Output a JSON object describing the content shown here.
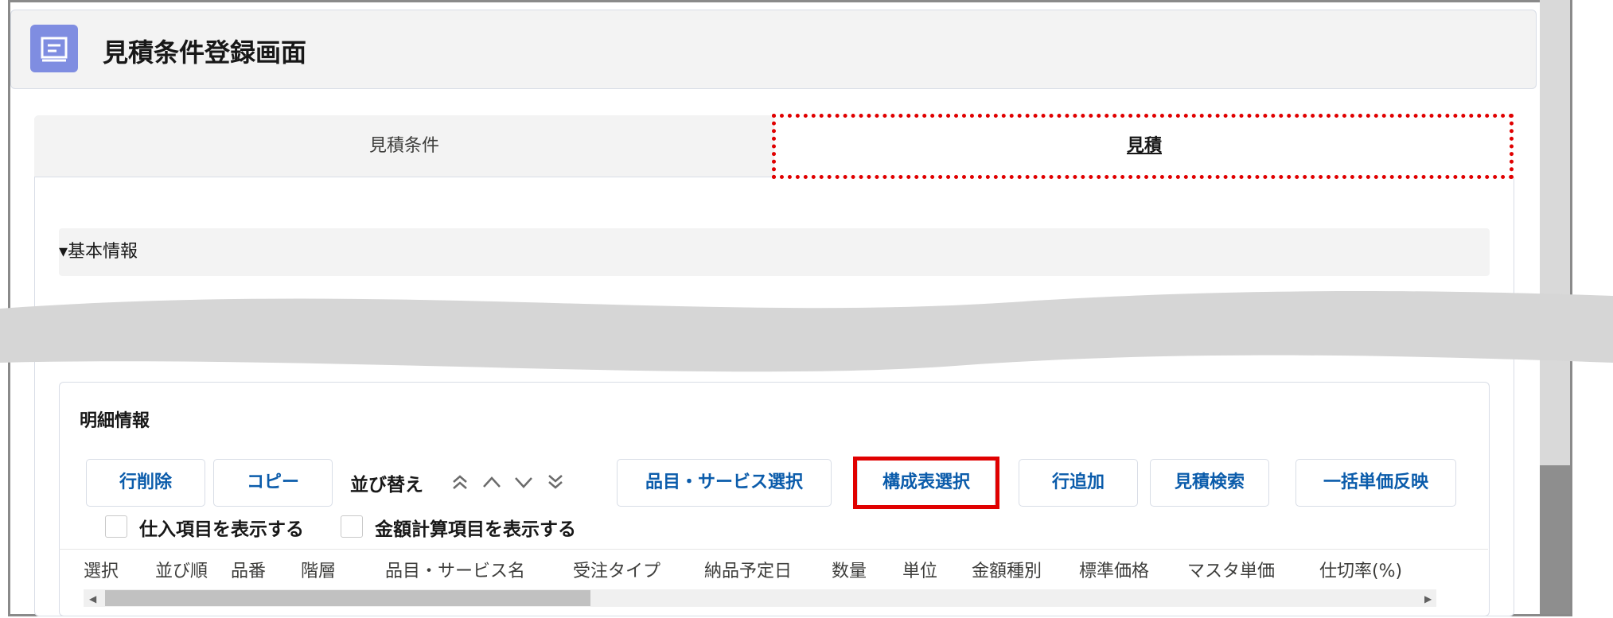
{
  "header": {
    "title": "見積条件登録画面",
    "icon": "quote-icon",
    "icon_color": "#7f8de1"
  },
  "tabs": [
    {
      "label": "見積条件",
      "active": false
    },
    {
      "label": "見積",
      "active": true
    }
  ],
  "section": {
    "label": "▾基本情報"
  },
  "detail": {
    "title": "明細情報",
    "buttons": {
      "delete_row": "行削除",
      "copy": "コピー",
      "product_select": "品目・サービス選択",
      "config_select": "構成表選択",
      "add_row": "行追加",
      "quote_search": "見積検索",
      "bulk_price": "一括単価反映"
    },
    "sort": {
      "label": "並び替え",
      "icons": [
        "double-up-icon",
        "up-icon",
        "down-icon",
        "double-down-icon"
      ]
    },
    "checkboxes": {
      "show_purchase": "仕入項目を表示する",
      "show_amount_calc": "金額計算項目を表示する"
    },
    "columns": [
      "選択",
      "並び順",
      "品番",
      "階層",
      "品目・サービス名",
      "受注タイプ",
      "納品予定日",
      "数量",
      "単位",
      "金額種別",
      "標準価格",
      "マスタ単価",
      "仕切率(%)"
    ]
  },
  "colors": {
    "highlight": "#e00000",
    "link": "#0b5cab"
  }
}
